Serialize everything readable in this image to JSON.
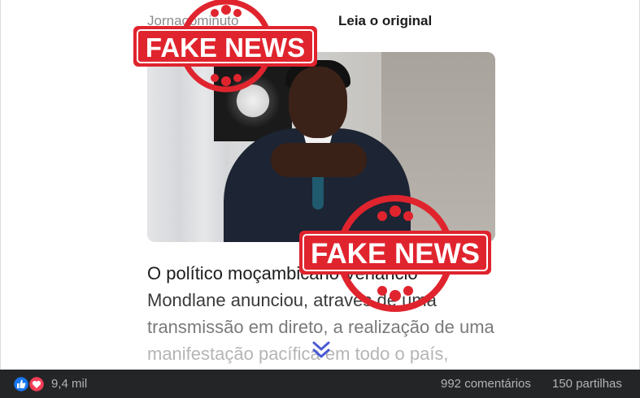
{
  "header": {
    "source_name": "Jornaoominuto",
    "read_original": "Leia o original"
  },
  "stamps": {
    "label": "FAKE NEWS",
    "color": "#e0242e"
  },
  "article": {
    "lines": [
      "O político moçambicano Venâncio",
      "Mondlane anunciou, através de uma",
      "transmissão em direto, a realização de uma",
      "manifestação pacífica em todo o país,"
    ]
  },
  "footer": {
    "reaction_icons": [
      "like-icon",
      "love-icon"
    ],
    "reaction_count": "9,4 mil",
    "comments": "992 comentários",
    "shares": "150 partilhas"
  },
  "colors": {
    "footer_bg": "#242526",
    "footer_text": "#b0b3b8",
    "like_blue": "#1877f2",
    "love_red": "#f33e58",
    "chevron": "#4a5bd4"
  }
}
